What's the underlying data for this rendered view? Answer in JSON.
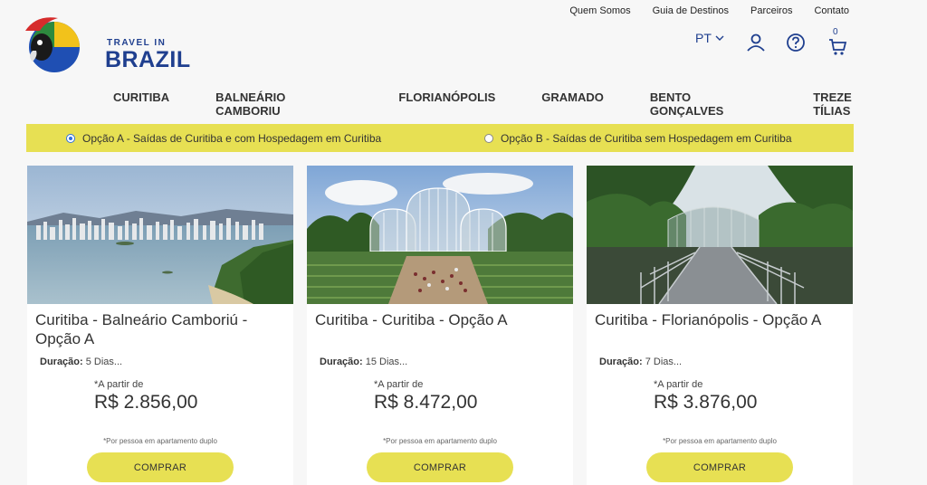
{
  "brand": {
    "small": "TRAVEL IN",
    "big": "BRAZIL"
  },
  "topnav": [
    "Quem Somos",
    "Guia de Destinos",
    "Parceiros",
    "Contato"
  ],
  "utility": {
    "language": "PT",
    "cart_count": "0"
  },
  "categories": [
    {
      "label": "CURITIBA",
      "active": true
    },
    {
      "label": "BALNEÁRIO CAMBORIU",
      "active": false
    },
    {
      "label": "FLORIANÓPOLIS",
      "active": false
    },
    {
      "label": "GRAMADO",
      "active": false
    },
    {
      "label": "BENTO GONÇALVES",
      "active": false
    },
    {
      "label": "TREZE TÍLIAS",
      "active": false
    }
  ],
  "options": {
    "a": {
      "label": "Opção A - Saídas de Curitiba e com Hospedagem em Curitiba",
      "selected": true
    },
    "b": {
      "label": "Opção B - Saídas de Curitiba sem Hospedagem em Curitiba",
      "selected": false
    }
  },
  "cards": [
    {
      "title": "Curitiba - Balneário Camboriú - Opção A",
      "duration_label": "Duração:",
      "duration_value": "5 Dias...",
      "from": "*A partir de",
      "price": "R$ 2.856,00",
      "note": "*Por pessoa em apartamento duplo",
      "button": "COMPRAR"
    },
    {
      "title": "Curitiba - Curitiba - Opção A",
      "duration_label": "Duração:",
      "duration_value": "15 Dias...",
      "from": "*A partir de",
      "price": "R$ 8.472,00",
      "note": "*Por pessoa em apartamento duplo",
      "button": "COMPRAR"
    },
    {
      "title": "Curitiba - Florianópolis - Opção A",
      "duration_label": "Duração:",
      "duration_value": "7 Dias...",
      "from": "*A partir de",
      "price": "R$ 3.876,00",
      "note": "*Por pessoa em apartamento duplo",
      "button": "COMPRAR"
    }
  ],
  "colors": {
    "accent_yellow": "#e7e053",
    "brand_blue": "#1f3f8f"
  }
}
